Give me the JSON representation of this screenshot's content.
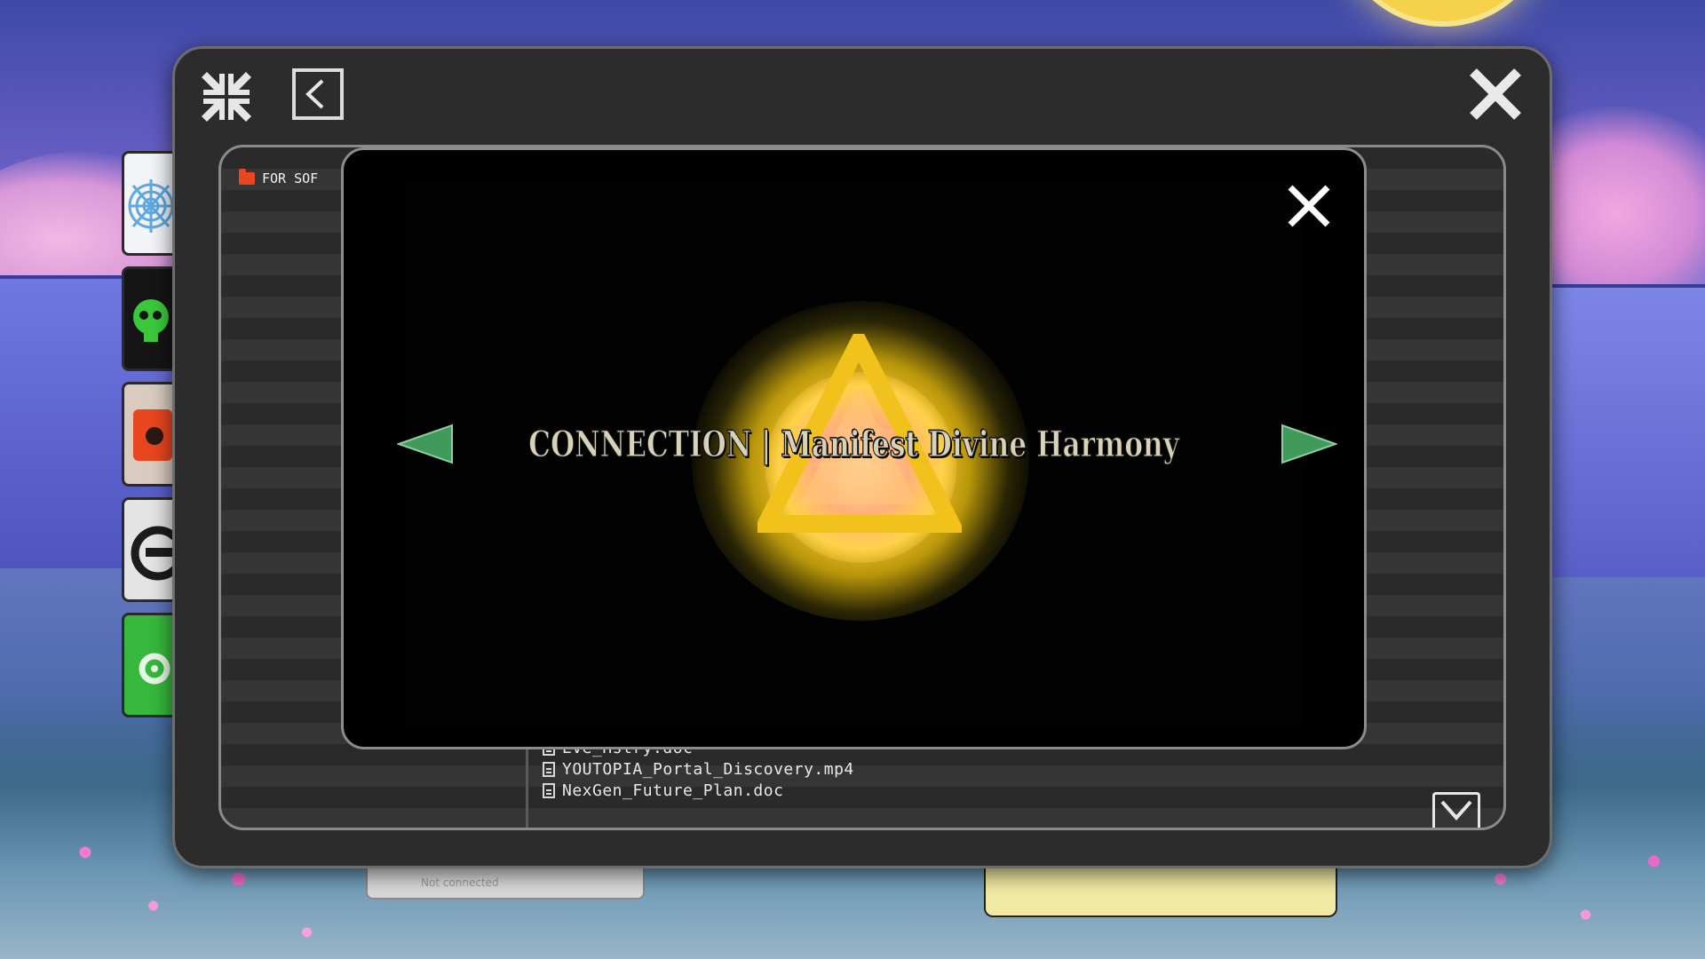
{
  "explorer": {
    "folder_label": "FOR SOF",
    "files": [
      "Eve_Hstry.doc",
      "YOUTOPIA_Portal_Discovery.mp4",
      "NexGen_Future_Plan.doc"
    ]
  },
  "viewer": {
    "title": "CONNECTION | Manifest Divine Harmony"
  },
  "status_bar": {
    "text": "Not connected"
  },
  "colors": {
    "window_bg": "#2c2c2d",
    "folder_icon": "#e8461e",
    "nav_arrow": "#3f9a5c",
    "glow": "#ffe46a",
    "triangle": "#f2c21c"
  }
}
